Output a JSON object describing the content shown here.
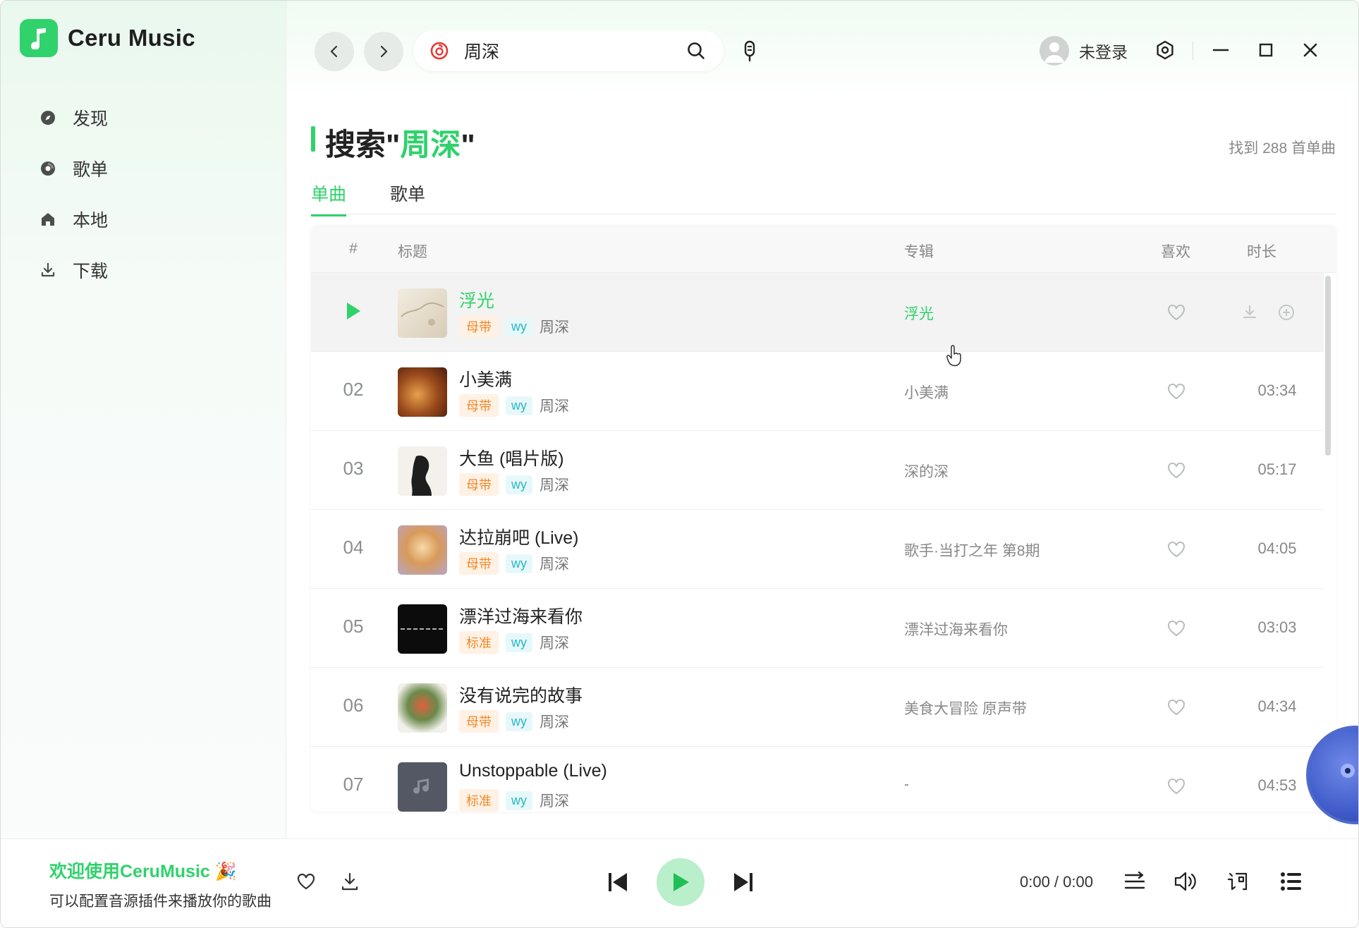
{
  "app": {
    "name": "Ceru Music",
    "accent": "#2fd26b"
  },
  "sidebar": {
    "items": [
      {
        "label": "发现",
        "icon": "compass-icon"
      },
      {
        "label": "歌单",
        "icon": "disc-icon"
      },
      {
        "label": "本地",
        "icon": "home-icon"
      },
      {
        "label": "下载",
        "icon": "download-icon"
      }
    ]
  },
  "header": {
    "search_value": "周深",
    "user_label": "未登录"
  },
  "main": {
    "title_prefix": "搜索\"",
    "keyword": "周深",
    "title_suffix": "\"",
    "found_text": "找到 288 首单曲",
    "tabs": [
      {
        "label": "单曲",
        "active": true
      },
      {
        "label": "歌单",
        "active": false
      }
    ],
    "columns": {
      "num": "#",
      "title": "标题",
      "album": "专辑",
      "like": "喜欢",
      "duration": "时长"
    },
    "rows": [
      {
        "num": "",
        "title": "浮光",
        "quality": "母带",
        "source": "wy",
        "artist": "周深",
        "album": "浮光",
        "duration": "",
        "playing": true
      },
      {
        "num": "02",
        "title": "小美满",
        "quality": "母带",
        "source": "wy",
        "artist": "周深",
        "album": "小美满",
        "duration": "03:34"
      },
      {
        "num": "03",
        "title": "大鱼 (唱片版)",
        "quality": "母带",
        "source": "wy",
        "artist": "周深",
        "album": "深的深",
        "duration": "05:17"
      },
      {
        "num": "04",
        "title": "达拉崩吧 (Live)",
        "quality": "母带",
        "source": "wy",
        "artist": "周深",
        "album": "歌手·当打之年 第8期",
        "duration": "04:05"
      },
      {
        "num": "05",
        "title": "漂洋过海来看你",
        "quality": "标准",
        "source": "wy",
        "artist": "周深",
        "album": "漂洋过海来看你",
        "duration": "03:03"
      },
      {
        "num": "06",
        "title": "没有说完的故事",
        "quality": "母带",
        "source": "wy",
        "artist": "周深",
        "album": "美食大冒险 原声带",
        "duration": "04:34"
      },
      {
        "num": "07",
        "title": "Unstoppable (Live)",
        "quality": "标准",
        "source": "wy",
        "artist": "周深",
        "album": "-",
        "duration": "04:53"
      }
    ]
  },
  "player": {
    "title": "欢迎使用CeruMusic 🎉",
    "subtitle": "可以配置音源插件来播放你的歌曲",
    "time": "0:00 / 0:00"
  }
}
